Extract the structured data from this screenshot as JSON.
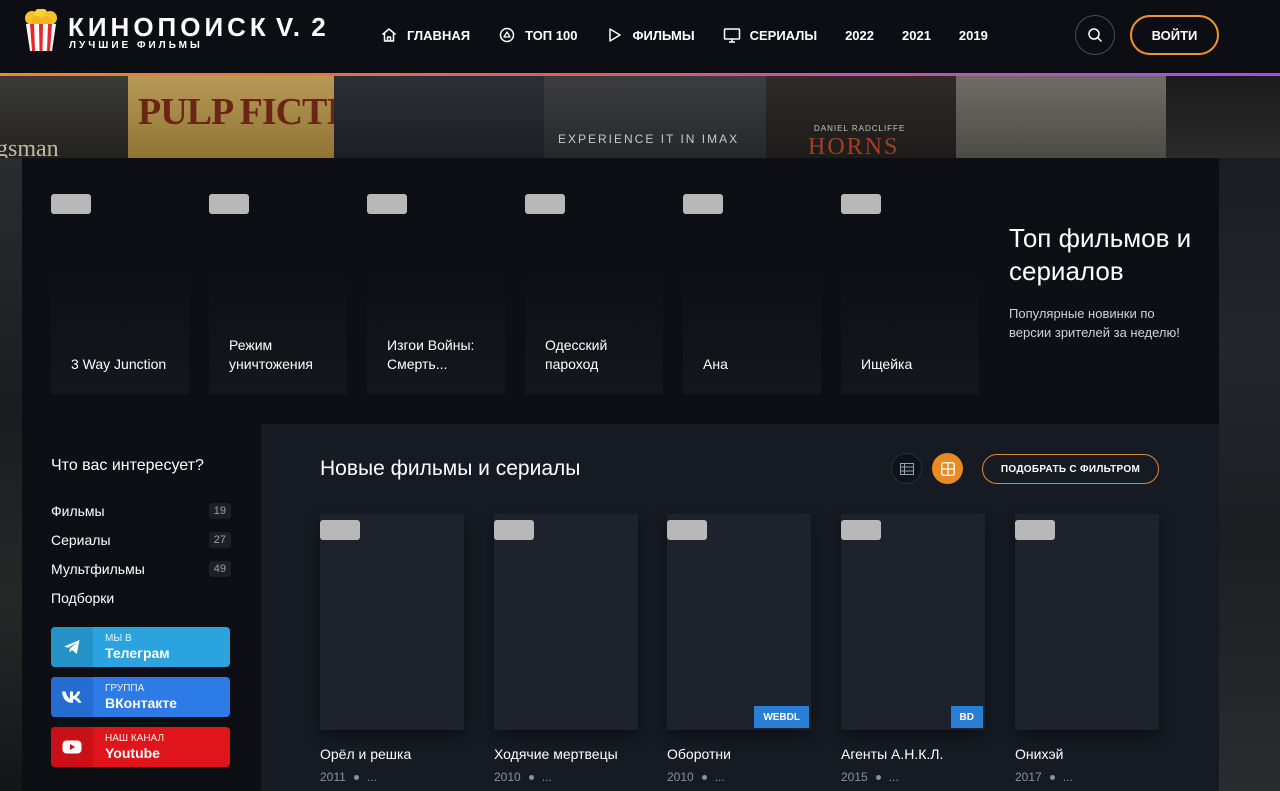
{
  "header": {
    "logo_title": "КИНОПОИСК",
    "logo_version": "V. 2",
    "logo_subtitle": "ЛУЧШИЕ ФИЛЬМЫ",
    "nav": [
      {
        "label": "ГЛАВНАЯ",
        "icon": "home-icon"
      },
      {
        "label": "ТОП 100",
        "icon": "badge-icon"
      },
      {
        "label": "ФИЛЬМЫ",
        "icon": "play-icon"
      },
      {
        "label": "СЕРИАЛЫ",
        "icon": "monitor-icon"
      },
      {
        "label": "2022"
      },
      {
        "label": "2021"
      },
      {
        "label": "2019"
      }
    ],
    "search_icon": "search-icon",
    "login_label": "ВОЙТИ"
  },
  "background_posters": {
    "texts": [
      "PULP FICTION",
      "gsman",
      "EXPERIENCE IT IN IMAX",
      "HORNS",
      "DANIEL RADCLIFFE"
    ]
  },
  "top": {
    "cards": [
      {
        "title": "3 Way Junction"
      },
      {
        "title": "Режим уничтожения"
      },
      {
        "title": "Изгои Войны: Смерть..."
      },
      {
        "title": "Одесский пароход"
      },
      {
        "title": "Ана"
      },
      {
        "title": "Ищейка"
      }
    ],
    "promo_title": "Топ фильмов и сериалов",
    "promo_desc": "Популярные новинки по версии зрителей за неделю!"
  },
  "sidebar": {
    "title": "Что вас интересует?",
    "items": [
      {
        "label": "Фильмы",
        "count": "19"
      },
      {
        "label": "Сериалы",
        "count": "27"
      },
      {
        "label": "Мультфильмы",
        "count": "49"
      },
      {
        "label": "Подборки",
        "count": ""
      }
    ],
    "socials": [
      {
        "small": "МЫ В",
        "big": "Телеграм",
        "icon": "telegram-icon",
        "color": "#2aa3df"
      },
      {
        "small": "ГРУППА",
        "big": "ВКонтакте",
        "icon": "vk-icon",
        "color": "#2d7be6"
      },
      {
        "small": "НАШ КАНАЛ",
        "big": "Youtube",
        "icon": "youtube-icon",
        "color": "#e0141b"
      }
    ]
  },
  "main": {
    "title": "Новые фильмы и сериалы",
    "filter_label": "ПОДОБРАТЬ С ФИЛЬТРОМ",
    "movies": [
      {
        "title": "Орёл и решка",
        "year": "2011",
        "extra": "...",
        "badge": ""
      },
      {
        "title": "Ходячие мертвецы",
        "year": "2010",
        "extra": "...",
        "badge": ""
      },
      {
        "title": "Оборотни",
        "year": "2010",
        "extra": "...",
        "badge": "WEBDL"
      },
      {
        "title": "Агенты А.Н.К.Л.",
        "year": "2015",
        "extra": "...",
        "badge": "BD"
      },
      {
        "title": "Онихэй",
        "year": "2017",
        "extra": "...",
        "badge": ""
      }
    ]
  },
  "colors": {
    "accent": "#e88b22",
    "header_gradient_start": "#f08a24",
    "header_gradient_end": "#a84cf0",
    "badge_blue": "#2a7fd4"
  }
}
